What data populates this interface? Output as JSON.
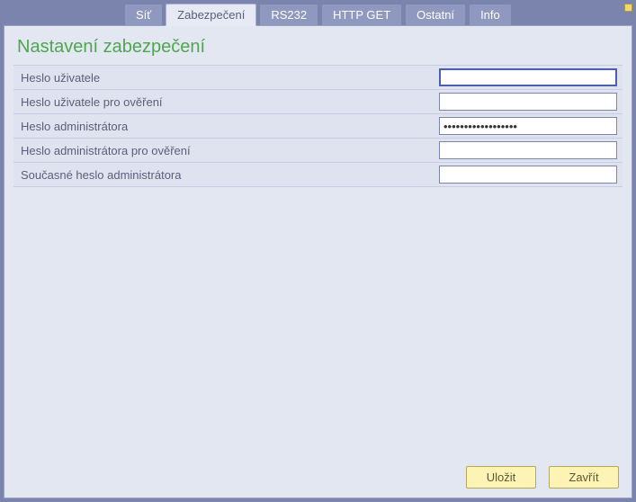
{
  "tabs": {
    "network": "Síť",
    "security": "Zabezpečení",
    "rs232": "RS232",
    "httpget": "HTTP GET",
    "other": "Ostatní",
    "info": "Info"
  },
  "title": "Nastavení zabezpečení",
  "fields": {
    "user_password": {
      "label": "Heslo uživatele",
      "value": ""
    },
    "user_password_confirm": {
      "label": "Heslo uživatele pro ověření",
      "value": ""
    },
    "admin_password": {
      "label": "Heslo administrátora",
      "value": "••••••••••••••••••"
    },
    "admin_password_confirm": {
      "label": "Heslo administrátora pro ověření",
      "value": ""
    },
    "current_admin_password": {
      "label": "Současné heslo administrátora",
      "value": ""
    }
  },
  "buttons": {
    "save": "Uložit",
    "close": "Zavřít"
  }
}
